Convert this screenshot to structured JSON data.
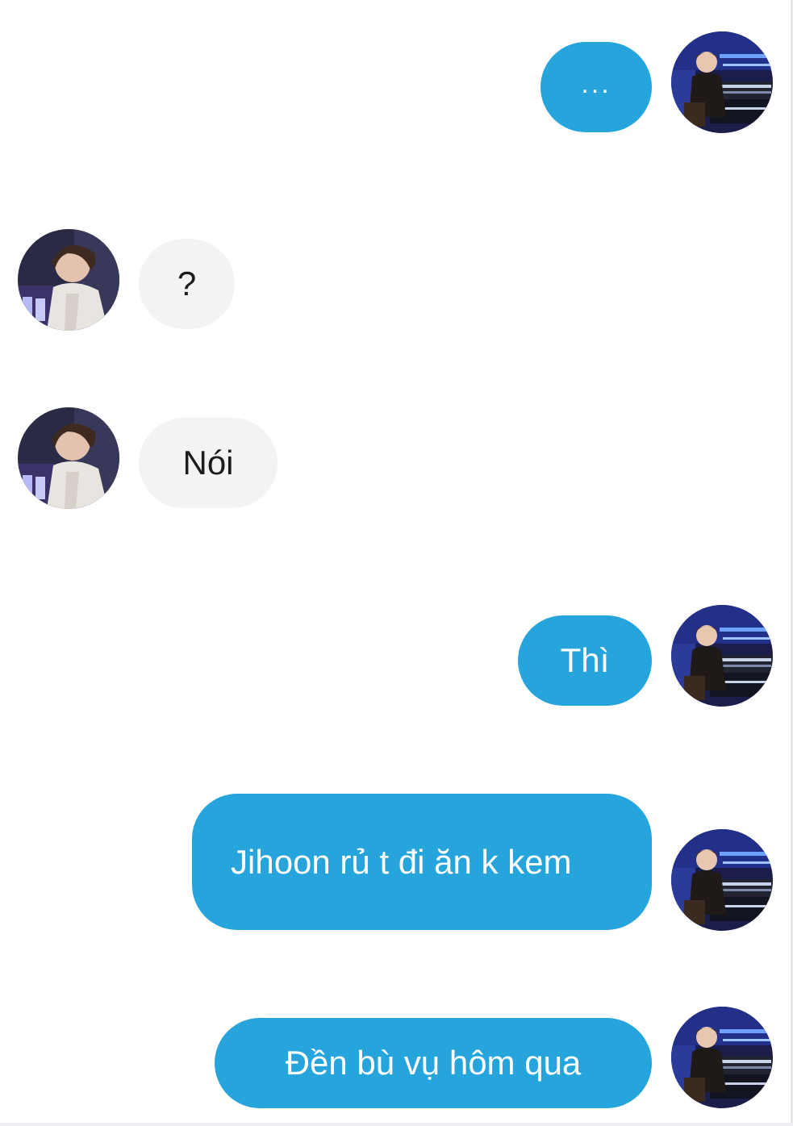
{
  "conversation": {
    "messages": [
      {
        "side": "outgoing",
        "text": "..."
      },
      {
        "side": "incoming",
        "text": "?"
      },
      {
        "side": "incoming",
        "text": "Nói"
      },
      {
        "side": "outgoing",
        "text": "Thì"
      },
      {
        "side": "outgoing",
        "text": "Jihoon rủ t đi ăn k kem"
      },
      {
        "side": "outgoing",
        "text": "Đền bù vụ hôm qua"
      }
    ]
  },
  "colors": {
    "outgoing_bubble": "#26a4dc",
    "incoming_bubble": "#f2f3f5",
    "background": "#ffffff"
  },
  "icons": {
    "me_avatar": "avatar-pianist-stage-photo",
    "them_avatar": "avatar-seated-person-photo"
  }
}
